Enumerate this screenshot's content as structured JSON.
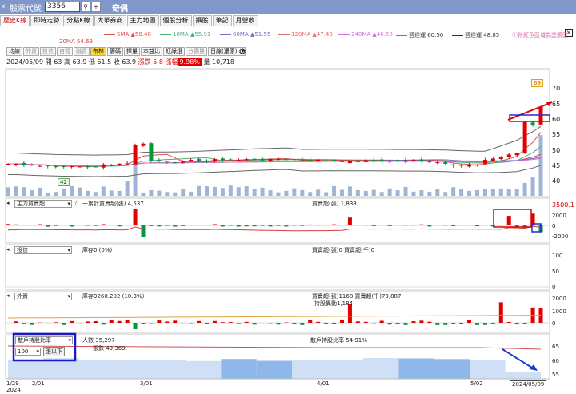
{
  "topbar": {
    "back_icon": "chevron-left-icon",
    "label": "股票代號",
    "code": "3356",
    "stock_name": "奇偶"
  },
  "tabs": [
    "歷史K線",
    "即時走勢",
    "分點K線",
    "大單券商",
    "主力地圖",
    "個股分析",
    "攝股",
    "筆記",
    "月營收"
  ],
  "close_label": "×",
  "ma_legend": [
    {
      "label": "5MA ▲58.48",
      "color": "#e05050"
    },
    {
      "label": "10MA ▲55.91",
      "color": "#4caf7a"
    },
    {
      "label": "60MA ▲51.55",
      "color": "#7a6acd"
    },
    {
      "label": "120MA ▲47.43",
      "color": "#e07070"
    },
    {
      "label": "240MA ▲46.58",
      "color": "#d070d0"
    },
    {
      "label": "週達運 60.50",
      "color": "#777777"
    },
    {
      "label": "週達運 48.85",
      "color": "#333333"
    },
    {
      "label": "20MA 54.68",
      "color": "#d04040"
    }
  ],
  "promo": "粉紅色區域為塗鴉區",
  "toolbar": [
    "均線",
    "外資",
    "投信",
    "自營",
    "融資",
    "布林",
    "籌碼",
    "擇量",
    "本益比",
    "紅綠燈",
    "分價量",
    "日線(還原)"
  ],
  "quote": {
    "date": "2024/05/09",
    "open": "開 63",
    "high": "高 63.9",
    "low": "低 61.5",
    "close": "收 63.9",
    "change": "漲跌 5.8",
    "pct_label": "漲幅",
    "pct": "9.98%",
    "volume": "量 10,718"
  },
  "main_chart": {
    "y_ticks": [
      "70",
      "65",
      "60",
      "55",
      "50",
      "45",
      "40"
    ],
    "label_high": "69",
    "label_low": "42"
  },
  "panel_main_force": {
    "selector": "主力買賣超",
    "help": "?",
    "legend1": "一累計買賣超(張) 4,537",
    "legend2": "買賣超(張) 1,838",
    "y_ticks": [
      "3500.1",
      "2000",
      "0",
      "-2000"
    ]
  },
  "panel_trust": {
    "selector": "投信",
    "legend1": "庫存0 (0%)",
    "legend2": "買賣超(張)0 買賣超(千)0",
    "y_ticks": [
      "100",
      "50",
      "0"
    ]
  },
  "panel_foreign": {
    "selector": "外資",
    "legend1": "庫存9260.202 (10.3%)",
    "legend2": "買賣超(張)1168 買賣超(千)73,887",
    "legend3": "持股異動1,184",
    "y_ticks": [
      "2000",
      "1000",
      "0"
    ]
  },
  "panel_holders": {
    "selector": "散戶持股比率",
    "count": "100",
    "below": "張以下",
    "legend1": "人數 35,297",
    "legend2": "張數 49,369",
    "legend3": "散戶持股比率 54.91%",
    "y_ticks": [
      "65",
      "60",
      "55"
    ]
  },
  "x_axis": [
    "1/29\n2024",
    "2/01",
    "3/01",
    "4/01",
    "5/02",
    "2024/05/09"
  ],
  "chart_data": [
    {
      "type": "candlestick",
      "title": "",
      "ylim": [
        38,
        72
      ],
      "x": [
        "1/29",
        "2/01",
        "3/01",
        "4/01",
        "5/02",
        "2024/05/09"
      ],
      "last": {
        "date": "2024/05/09",
        "open": 63,
        "high": 63.9,
        "low": 61.5,
        "close": 63.9,
        "volume": 10718
      },
      "annotations": [
        "69",
        "42"
      ]
    },
    {
      "type": "bar",
      "title": "主力買賣超",
      "ylim": [
        -2000,
        3500
      ],
      "values": [
        1838
      ],
      "line_series": [
        {
          "name": "累計買賣超(張)",
          "last": 4537
        }
      ]
    },
    {
      "type": "bar",
      "title": "外資",
      "ylim": [
        -500,
        2500
      ],
      "values": [
        1168
      ]
    },
    {
      "type": "area",
      "title": "散戶持股比率",
      "ylim": [
        53,
        66
      ],
      "series": [
        {
          "name": "散戶持股比率",
          "last": 54.91
        }
      ]
    }
  ]
}
